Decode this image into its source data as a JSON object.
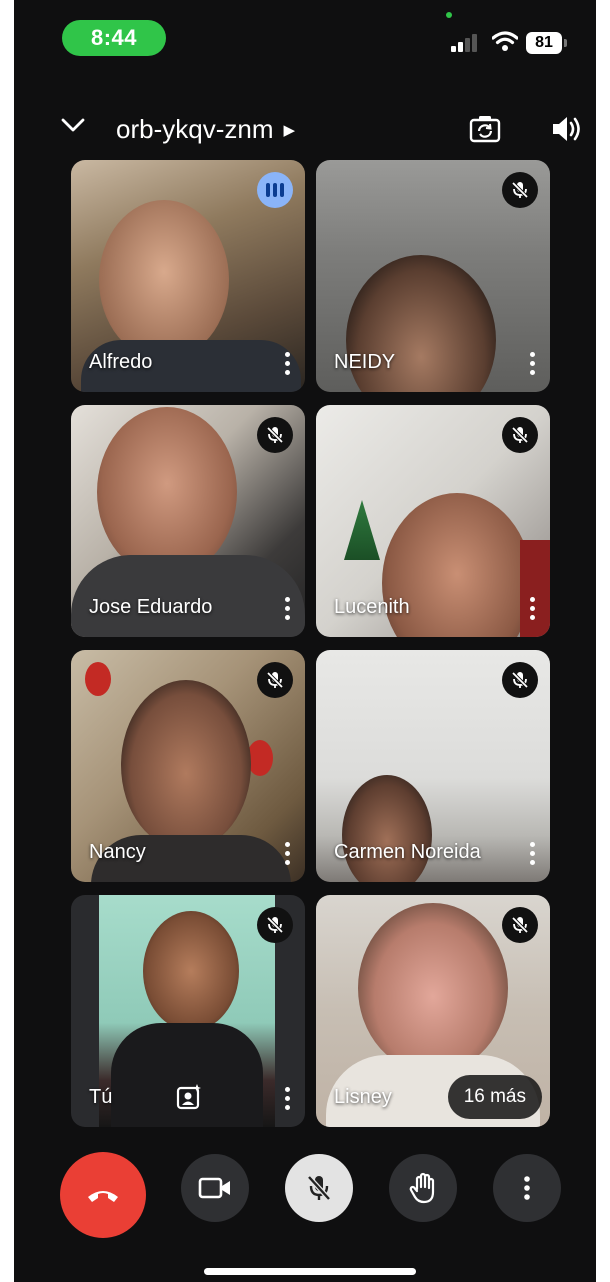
{
  "status": {
    "time": "8:44",
    "battery": "81"
  },
  "header": {
    "meeting_code": "orb-ykqv-znm",
    "icons": [
      "chevron-down-icon",
      "chevron-right-icon",
      "flip-camera-icon",
      "speaker-icon"
    ]
  },
  "participants": [
    {
      "name": "Alfredo",
      "state": "speaking"
    },
    {
      "name": "NEIDY",
      "state": "muted"
    },
    {
      "name": "Jose Eduardo",
      "state": "muted"
    },
    {
      "name": "Lucenith",
      "state": "muted"
    },
    {
      "name": "Nancy",
      "state": "muted"
    },
    {
      "name": "Carmen Noreida",
      "state": "muted"
    },
    {
      "name": "Tú",
      "state": "muted"
    },
    {
      "name": "Lisney",
      "state": "muted"
    }
  ],
  "overflow": {
    "label": "16 más"
  },
  "controls": [
    {
      "name": "end-call",
      "icon": "phone-hangup-icon"
    },
    {
      "name": "camera",
      "icon": "video-camera-icon"
    },
    {
      "name": "microphone",
      "icon": "mic-off-icon"
    },
    {
      "name": "raise-hand",
      "icon": "hand-icon"
    },
    {
      "name": "more-options",
      "icon": "more-vert-icon"
    }
  ],
  "colors": {
    "end_call": "#ea3f35",
    "status_time_pill": "#30c549",
    "speaking_badge": "#8ab4f8",
    "background": "#0f0f10"
  }
}
